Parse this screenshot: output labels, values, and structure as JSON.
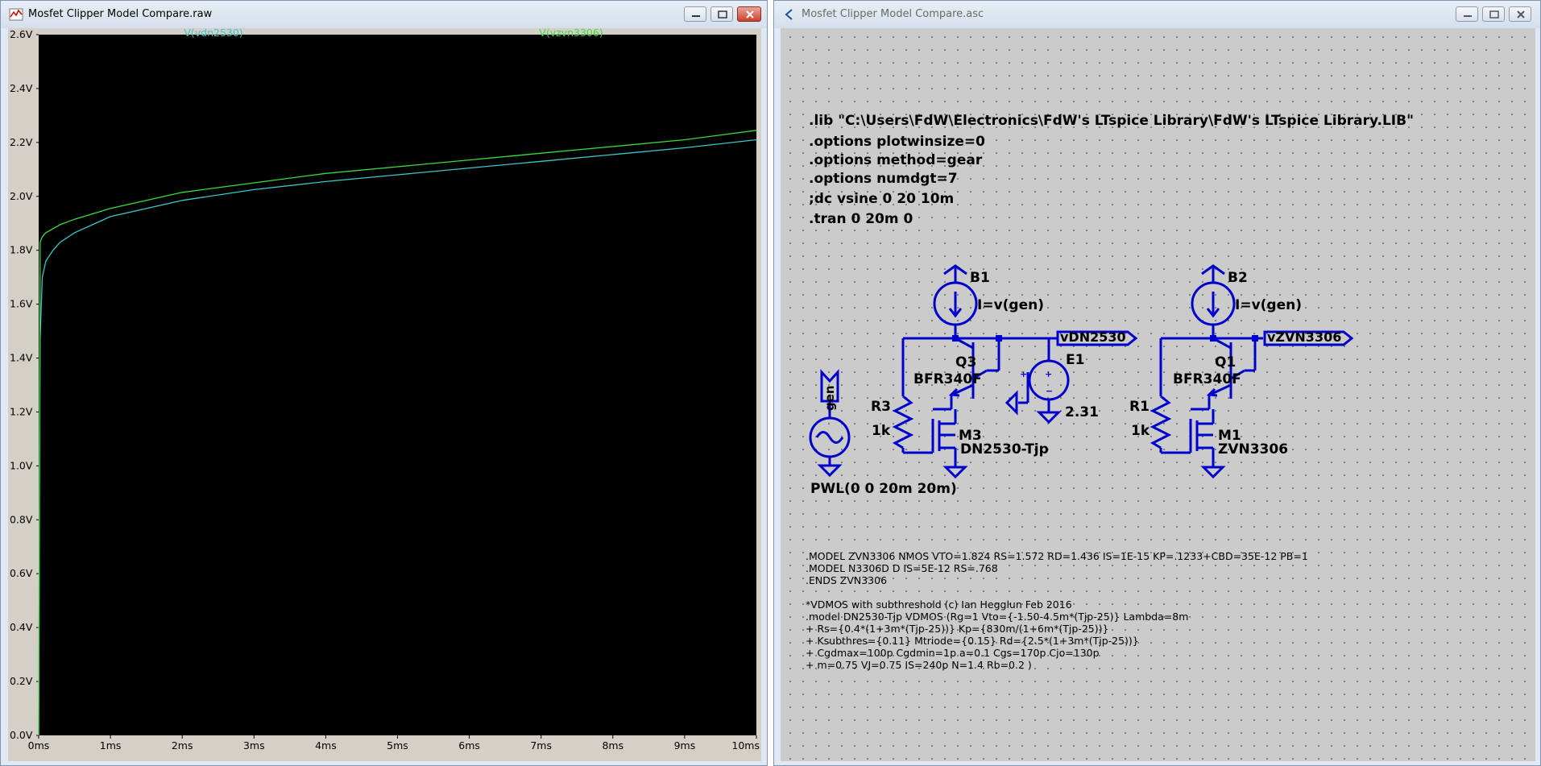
{
  "left_window": {
    "title": "Mosfet Clipper Model Compare.raw",
    "trace1_label": "V(vdn2530)",
    "trace2_label": "V(vzvn3306)"
  },
  "right_window": {
    "title": "Mosfet Clipper Model Compare.asc"
  },
  "colors": {
    "plot_bg": "#000000",
    "trace_vdn2530": "#3ec7c7",
    "trace_vzvn3306": "#3bdc3b",
    "wire": "#0000cc",
    "axis_text": "#000000"
  },
  "chart_data": {
    "type": "line",
    "title": "",
    "xlabel": "",
    "ylabel": "",
    "xlim": [
      0,
      10
    ],
    "ylim": [
      0,
      2.6
    ],
    "x_ticks": [
      "0ms",
      "1ms",
      "2ms",
      "3ms",
      "4ms",
      "5ms",
      "6ms",
      "7ms",
      "8ms",
      "9ms",
      "10ms"
    ],
    "y_ticks": [
      "0.0V",
      "0.2V",
      "0.4V",
      "0.6V",
      "0.8V",
      "1.0V",
      "1.2V",
      "1.4V",
      "1.6V",
      "1.8V",
      "2.0V",
      "2.2V",
      "2.4V",
      "2.6V"
    ],
    "series": [
      {
        "name": "V(vdn2530)",
        "x_ms": [
          0,
          0.02,
          0.05,
          0.1,
          0.2,
          0.3,
          0.5,
          1,
          2,
          3,
          4,
          5,
          6,
          7,
          8,
          9,
          10
        ],
        "y": [
          0,
          1.47,
          1.7,
          1.76,
          1.8,
          1.83,
          1.865,
          1.925,
          1.985,
          2.025,
          2.055,
          2.08,
          2.105,
          2.13,
          2.155,
          2.18,
          2.21
        ]
      },
      {
        "name": "V(vzvn3306)",
        "x_ms": [
          0,
          0.02,
          0.05,
          0.1,
          0.2,
          0.3,
          0.5,
          1,
          2,
          3,
          4,
          5,
          6,
          7,
          8,
          9,
          10
        ],
        "y": [
          0,
          1.83,
          1.85,
          1.865,
          1.88,
          1.895,
          1.915,
          1.955,
          2.015,
          2.05,
          2.085,
          2.11,
          2.135,
          2.16,
          2.185,
          2.21,
          2.245
        ]
      }
    ]
  },
  "schematic": {
    "directives": [
      ".lib \"C:\\Users\\FdW\\Electronics\\FdW's LTspice Library\\FdW's LTspice Library.LIB\"",
      ".options plotwinsize=0",
      ".options method=gear",
      ".options numdgt=7",
      ";dc vsine 0 20 10m",
      ".tran 0 20m 0"
    ],
    "b1_name": "B1",
    "b1_value": "I=v(gen)",
    "b2_name": "B2",
    "b2_value": "I=v(gen)",
    "label_vdn": "vDN2530",
    "label_vzvn": "vZVN3306",
    "q3_name": "Q3",
    "q3_model": "BFR340F",
    "q1_name": "Q1",
    "q1_model": "BFR340F",
    "e1_name": "E1",
    "e1_value": "2.31",
    "r3_name": "R3",
    "r3_value": "1k",
    "r1_name": "R1",
    "r1_value": "1k",
    "m3_name": "M3",
    "m3_model": "DN2530-Tjp",
    "m1_name": "M1",
    "m1_model": "ZVN3306",
    "gen_label": "gen",
    "source_value": "PWL(0 0 20m 20m)",
    "model_lines": [
      ".MODEL ZVN3306 NMOS VTO=1.824 RS=1.572 RD=1.436 IS=1E-15 KP=.1233+CBD=35E-12 PB=1",
      ".MODEL N3306D D IS=5E-12 RS=.768",
      ".ENDS ZVN3306",
      "",
      "*VDMOS with subthreshold (c) Ian Hegglun Feb 2016",
      ".model DN2530-Tjp VDMOS (Rg=1 Vto={-1.50-4.5m*(Tjp-25)} Lambda=8m",
      "+ Rs={0.4*(1+3m*(Tjp-25))} Kp={830m/(1+6m*(Tjp-25))}",
      "+ Ksubthres={0.11} Mtriode={0.15} Rd={2.5*(1+3m*(Tjp-25))}",
      "+ Cgdmax=100p Cgdmin=1p a=0.1 Cgs=170p Cjo=130p",
      "+ m=0.75 VJ=0.75 IS=240p N=1.4 Rb=0.2 )"
    ]
  }
}
